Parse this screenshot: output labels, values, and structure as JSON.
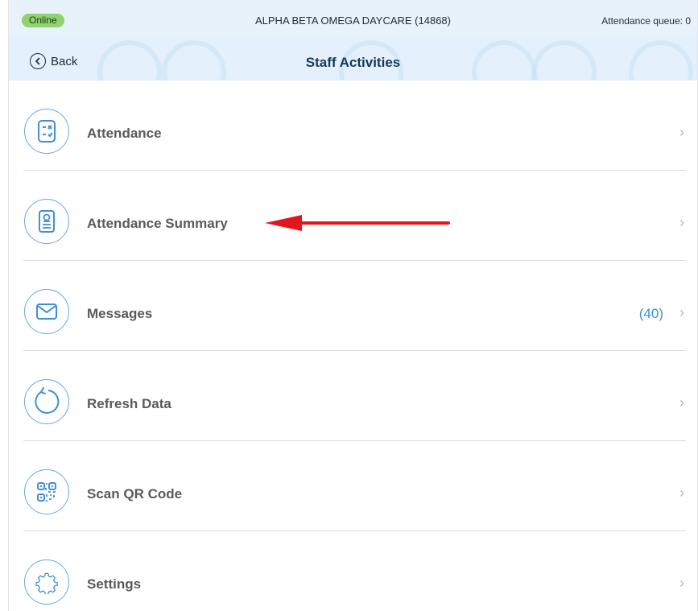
{
  "status_bar": {
    "status": "Online",
    "center_name": "ALPHA BETA OMEGA DAYCARE (14868)",
    "queue": "Attendance queue: 0"
  },
  "header": {
    "back_label": "Back",
    "title": "Staff Activities"
  },
  "menu": [
    {
      "label": "Attendance",
      "icon": "attendance-checklist-icon",
      "badge": ""
    },
    {
      "label": "Attendance Summary",
      "icon": "attendance-summary-document-icon",
      "badge": ""
    },
    {
      "label": "Messages",
      "icon": "envelope-icon",
      "badge": "(40)"
    },
    {
      "label": "Refresh Data",
      "icon": "refresh-icon",
      "badge": ""
    },
    {
      "label": "Scan QR Code",
      "icon": "qr-code-icon",
      "badge": ""
    },
    {
      "label": "Settings",
      "icon": "gear-icon",
      "badge": ""
    }
  ],
  "colors": {
    "accent": "#3f8fd8",
    "online": "#8fd26f",
    "annotation_arrow": "#e3171b"
  }
}
